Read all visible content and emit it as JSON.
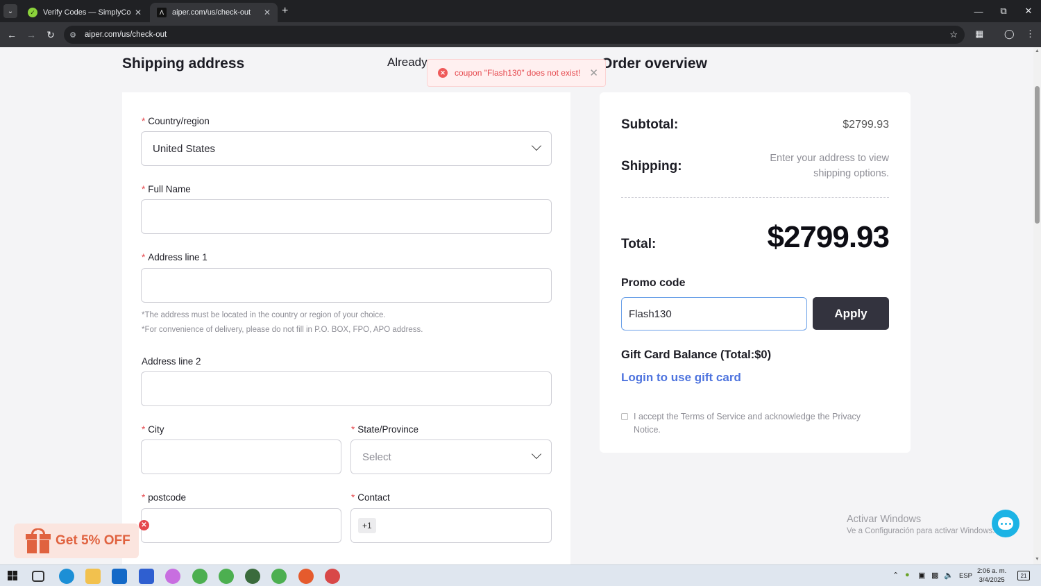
{
  "browser": {
    "tabs": [
      {
        "title": "Verify Codes — SimplyCodes",
        "favicon": "simplycodes-check-icon",
        "active": false
      },
      {
        "title": "aiper.com/us/check-out",
        "favicon": "aiper-logo-icon",
        "active": true
      }
    ],
    "url": "aiper.com/us/check-out"
  },
  "page": {
    "shipping_heading": "Shipping address",
    "already_partial": "Already",
    "overview_heading": "Order overview",
    "toast": {
      "message": "coupon \"Flash130\" does not exist!"
    }
  },
  "form": {
    "country_label": "Country/region",
    "country_value": "United States",
    "fullname_label": "Full Name",
    "address1_label": "Address line 1",
    "note1": "*The address must be located in the country or region of your choice.",
    "note2": "*For convenience of delivery, please do not fill in P.O. BOX, FPO, APO address.",
    "address2_label": "Address line 2",
    "city_label": "City",
    "state_label": "State/Province",
    "state_placeholder": "Select",
    "postcode_label": "postcode",
    "contact_label": "Contact",
    "contact_code": "+1"
  },
  "summary": {
    "subtotal_label": "Subtotal:",
    "subtotal_value": "$2799.93",
    "shipping_label": "Shipping:",
    "shipping_note": "Enter your address to view shipping options.",
    "total_label": "Total:",
    "total_value": "$2799.93",
    "promo_label": "Promo code",
    "promo_value": "Flash130",
    "apply_label": "Apply",
    "gift_label": "Gift Card Balance (Total:$0)",
    "gift_link": "Login to use gift card",
    "terms": "I accept the Terms of Service and acknowledge the Privacy Notice."
  },
  "overlay": {
    "promo_pill": "Get 5% OFF",
    "watermark_title": "Activar Windows",
    "watermark_sub": "Ve a Configuración para activar Windows."
  },
  "taskbar": {
    "lang": "ESP",
    "time": "2:06 a. m.",
    "date": "3/4/2025",
    "notif_count": "21"
  },
  "colors": {
    "accent_link": "#4d73de",
    "apply_button": "#33333e",
    "error": "#e5484d",
    "promo_orange": "#e0623f",
    "chat_blue": "#1cb3e5"
  }
}
